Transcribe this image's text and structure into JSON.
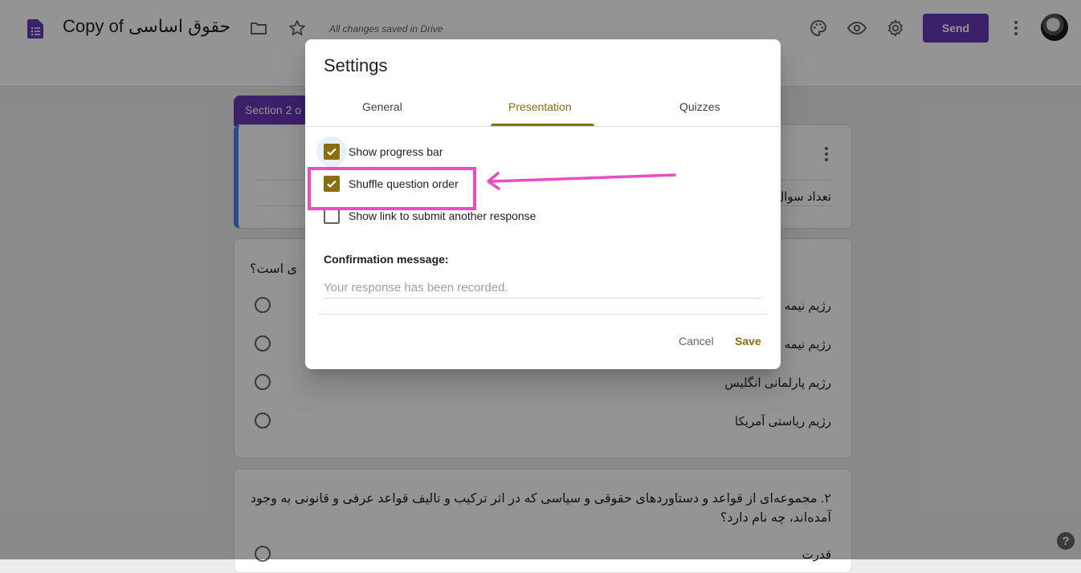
{
  "header": {
    "doc_title": "Copy of حقوق اساسی",
    "saved_status": "All changes saved in Drive",
    "send_label": "Send",
    "icons": [
      "forms-icon",
      "folder-icon",
      "star-icon",
      "palette-icon",
      "preview-eye-icon",
      "settings-gear-icon",
      "more-vert-icon",
      "avatar"
    ]
  },
  "form": {
    "section_tab": "Section 2 o",
    "header_card_text": "تعداد سوال",
    "q1": {
      "title": "ی است؟",
      "options": [
        "رژیم نیمه",
        "رژیم نیمه",
        "رژیم پارلمانی انگلیس",
        "رژیم ریاستی آمریکا"
      ]
    },
    "q2": {
      "title_line1": "۲. مجموعه‌ای از قواعد و دستاوردهای حقوقی و سیاسی که در اثر ترکیب و تالیف قواعد عرفی و قانونی به وجود",
      "title_line2": "آمده‌اند، چه نام دارد؟",
      "option1": "قدرت"
    },
    "help": "?"
  },
  "dialog": {
    "title": "Settings",
    "tabs": [
      {
        "label": "General",
        "active": false
      },
      {
        "label": "Presentation",
        "active": true
      },
      {
        "label": "Quizzes",
        "active": false
      }
    ],
    "options": [
      {
        "label": "Show progress bar",
        "checked": true
      },
      {
        "label": "Shuffle question order",
        "checked": true
      },
      {
        "label": "Show link to submit another response",
        "checked": false
      }
    ],
    "confirmation_label": "Confirmation message:",
    "confirmation_placeholder": "Your response has been recorded.",
    "confirmation_value": "",
    "cancel_label": "Cancel",
    "save_label": "Save"
  },
  "colors": {
    "accent": "#8a6d0b",
    "send_button": "#673ab7",
    "annotation": "#e94cc4"
  }
}
